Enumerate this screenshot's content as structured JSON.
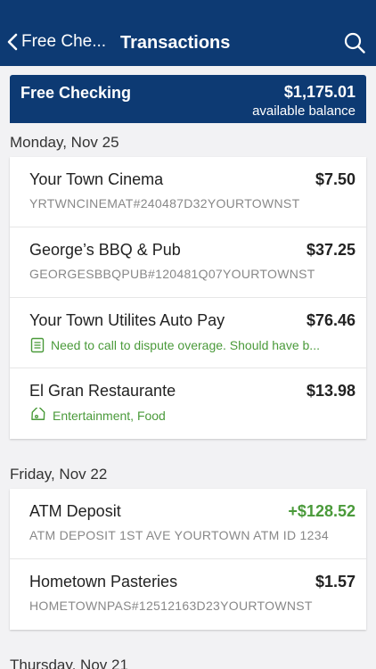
{
  "header": {
    "back_label": "Free Che...",
    "title": "Transactions"
  },
  "account": {
    "name": "Free Checking",
    "balance": "$1,175.01",
    "balance_label": "available balance"
  },
  "groups": [
    {
      "date": "Monday, Nov 25",
      "transactions": [
        {
          "name": "Your Town Cinema",
          "amount": "$7.50",
          "detail": "YRTWNCINEMAT#240487D32YOURTOWNST"
        },
        {
          "name": "George’s BBQ & Pub",
          "amount": "$37.25",
          "detail": "GEORGESBBQPUB#120481Q07YOURTOWNST"
        },
        {
          "name": "Your Town Utilites Auto Pay",
          "amount": "$76.46",
          "note": "Need to call to dispute overage. Should have b..."
        },
        {
          "name": "El Gran Restaurante",
          "amount": "$13.98",
          "tags": "Entertainment, Food"
        }
      ]
    },
    {
      "date": "Friday, Nov 22",
      "transactions": [
        {
          "name": "ATM Deposit",
          "amount": "+$128.52",
          "detail": "ATM DEPOSIT 1ST AVE YOURTOWN ATM ID 1234"
        },
        {
          "name": "Hometown Pasteries",
          "amount": "$1.57",
          "detail": "HOMETOWNPAS#12512163D23YOURTOWNST"
        }
      ]
    },
    {
      "date": "Thursday, Nov 21",
      "transactions": []
    }
  ],
  "colors": {
    "brand_navy": "#0d3a73",
    "credit_green": "#4a9a3a",
    "background": "#f2f2f4"
  },
  "icons": {
    "back": "chevron-left-icon",
    "search": "search-icon",
    "note": "note-icon",
    "tag": "tag-icon"
  }
}
